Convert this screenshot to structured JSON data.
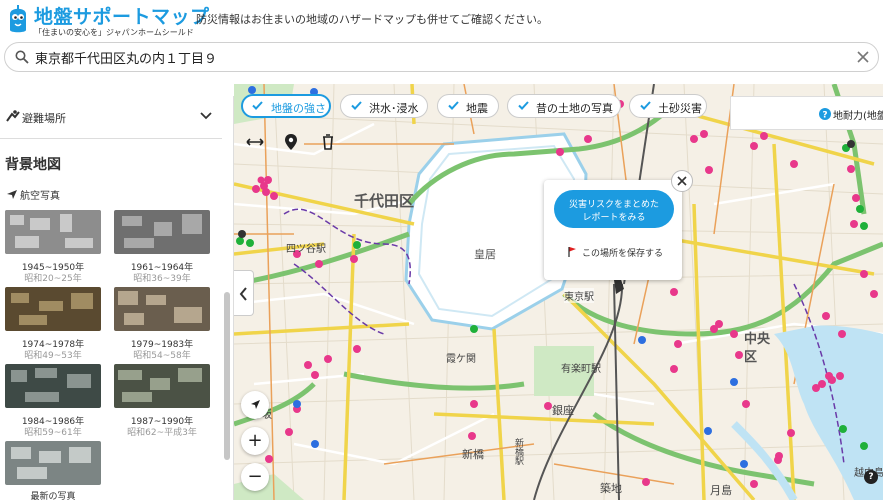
{
  "app": {
    "title": "地盤サポートマップ",
    "subtitle": "「住まいの安心を」ジャパンホームシールド",
    "tagline": "防災情報はお住まいの地域のハザードマップも併せてご確認ください。"
  },
  "search": {
    "value": "東京都千代田区丸の内１丁目９"
  },
  "filters": [
    {
      "label": "地盤の強さ",
      "active": true
    },
    {
      "label": "洪水･浸水",
      "active": false
    },
    {
      "label": "地震",
      "active": false
    },
    {
      "label": "昔の土地の写真",
      "active": false
    },
    {
      "label": "土砂災害",
      "active": false
    }
  ],
  "ground_badge": {
    "label": "地耐力(地盤"
  },
  "sidebar": {
    "evacuation_label": "避難場所",
    "background_heading": "背景地図",
    "aerial_label": "航空写真",
    "photos": [
      {
        "years": "1945~1950年",
        "era": "昭和20~25年"
      },
      {
        "years": "1961~1964年",
        "era": "昭和36~39年"
      },
      {
        "years": "1974~1978年",
        "era": "昭和49~53年"
      },
      {
        "years": "1979~1983年",
        "era": "昭和54~58年"
      },
      {
        "years": "1984~1986年",
        "era": "昭和59~61年"
      },
      {
        "years": "1987~1990年",
        "era": "昭和62~平成3年"
      },
      {
        "years": "最新の写真",
        "era": ""
      }
    ]
  },
  "popup": {
    "report_line1": "災害リスクをまとめた",
    "report_line2": "レポートをみる",
    "save_label": "この場所を保存する"
  },
  "map_labels": {
    "chiyoda": "千代田区",
    "kokyo": "皇居",
    "yotsuya": "四ツ谷駅",
    "tokyo_station": "東京駅",
    "chuo_line1": "中央",
    "chuo_line2": "区",
    "kasumigaseki": "霞ケ関",
    "yurakucho": "有楽町駅",
    "ginza": "銀座",
    "shinbashi": "新橋",
    "shinbashi_station": "新橋駅",
    "tsukiji": "築地",
    "tsukishima": "月島",
    "akasaka": "赤坂",
    "koshima": "越中島"
  },
  "controls": {
    "zoom_in": "+",
    "zoom_out": "−",
    "help": "?"
  },
  "colors": {
    "accent": "#1c9be0",
    "point_magenta": "#e8388b",
    "point_green": "#1fb03a",
    "point_blue": "#2d6fe0"
  }
}
